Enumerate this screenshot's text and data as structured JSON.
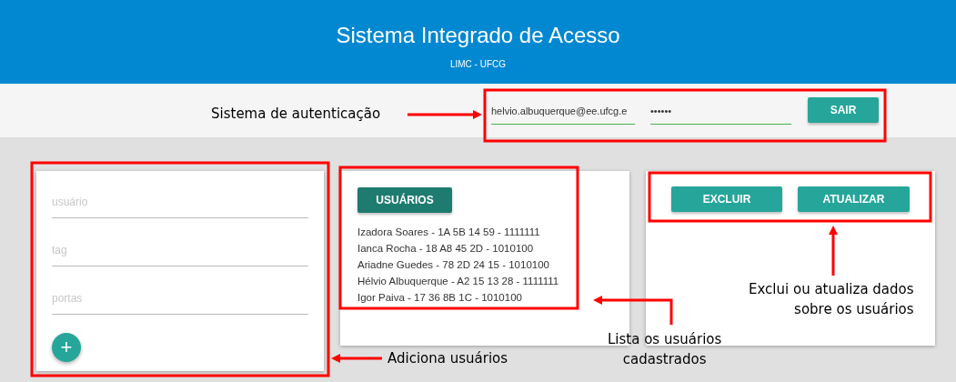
{
  "header": {
    "title": "Sistema Integrado de Acesso",
    "subtitle": "LIMC - UFCG"
  },
  "auth": {
    "email": "helvio.albuquerque@ee.ufcg.e",
    "password": "••••••",
    "button": "SAIR"
  },
  "add_card": {
    "fields": [
      {
        "placeholder": "usuário"
      },
      {
        "placeholder": "tag"
      },
      {
        "placeholder": "portas"
      }
    ],
    "add_button": "+"
  },
  "list_card": {
    "button": "USUÁRIOS",
    "users": [
      "Izadora Soares - 1A 5B 14 59 - 1111111",
      "Ianca Rocha - 18 A8 45 2D - 1010100",
      "Ariadne Guedes - 78 2D 24 15 - 1010100",
      "Hélvio Albuquerque - A2 15 13 28 - 1111111",
      "Igor Paiva - 17 36 8B 1C - 1010100"
    ]
  },
  "actions_card": {
    "buttons": [
      "EXCLUIR",
      "ATUALIZAR"
    ]
  },
  "annotations": [
    {
      "lines": [
        "Sistema de autenticação"
      ]
    },
    {
      "lines": [
        "Adiciona usuários"
      ]
    },
    {
      "lines": [
        "Lista os usuários",
        "cadastrados"
      ]
    },
    {
      "lines": [
        "Exclui ou atualiza dados",
        "sobre os usuários"
      ]
    }
  ]
}
